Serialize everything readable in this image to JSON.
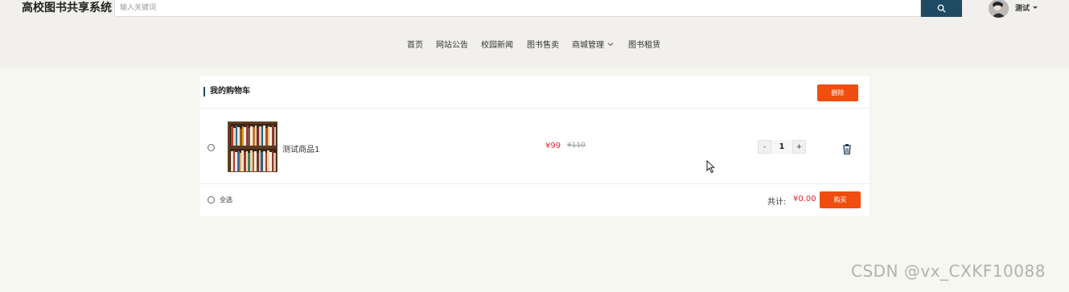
{
  "header": {
    "site_title": "高校图书共享系统",
    "search_placeholder": "输入关键词",
    "user_name": "测试"
  },
  "nav": [
    {
      "label": "首页"
    },
    {
      "label": "网站公告"
    },
    {
      "label": "校园新闻"
    },
    {
      "label": "图书售卖"
    },
    {
      "label": "商城管理"
    },
    {
      "label": "图书租赁"
    }
  ],
  "cart": {
    "title": "我的购物车",
    "delete_label": "删除",
    "items": [
      {
        "name": "测试商品1",
        "price": "¥99",
        "old_price": "¥110",
        "quantity": "1"
      }
    ],
    "minus": "-",
    "plus": "+",
    "select_all": "全选",
    "total_label": "共计:",
    "total_value": "¥0.00",
    "buy_label": "购买"
  },
  "watermark": "CSDN @vx_CXKF10088",
  "colors": {
    "accent_orange": "#f04e0e",
    "price_red": "#e8262b",
    "search_button": "#1f4a63"
  }
}
